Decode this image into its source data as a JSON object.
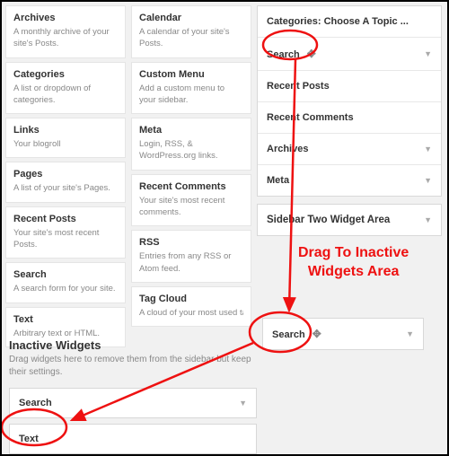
{
  "available": {
    "left": [
      {
        "title": "Archives",
        "desc": "A monthly archive of your site's Posts."
      },
      {
        "title": "Categories",
        "desc": "A list or dropdown of categories."
      },
      {
        "title": "Links",
        "desc": "Your blogroll"
      },
      {
        "title": "Pages",
        "desc": "A list of your site's Pages."
      },
      {
        "title": "Recent Posts",
        "desc": "Your site's most recent Posts."
      },
      {
        "title": "Search",
        "desc": "A search form for your site."
      },
      {
        "title": "Text",
        "desc": "Arbitrary text or HTML."
      }
    ],
    "right": [
      {
        "title": "Calendar",
        "desc": "A calendar of your site's Posts."
      },
      {
        "title": "Custom Menu",
        "desc": "Add a custom menu to your sidebar."
      },
      {
        "title": "Meta",
        "desc": "Login, RSS, & WordPress.org links."
      },
      {
        "title": "Recent Comments",
        "desc": "Your site's most recent comments."
      },
      {
        "title": "RSS",
        "desc": "Entries from any RSS or Atom feed."
      },
      {
        "title": "Tag Cloud",
        "desc": "A cloud of your most used tags."
      }
    ]
  },
  "sidebar_one": {
    "top_item": "Categories: Choose A Topic ...",
    "items": [
      "Search",
      "Recent Posts",
      "Recent Comments",
      "Archives",
      "Meta"
    ]
  },
  "sidebar_two_label": "Sidebar Two Widget Area",
  "inactive": {
    "heading": "Inactive Widgets",
    "desc": "Drag widgets here to remove them from the sidebar but keep their settings.",
    "items": [
      "Search",
      "Text"
    ]
  },
  "floating_drag_label": "Search",
  "annotation": "Drag To Inactive\nWidgets Area",
  "glyph": {
    "tri": "▼",
    "move": "✥"
  }
}
